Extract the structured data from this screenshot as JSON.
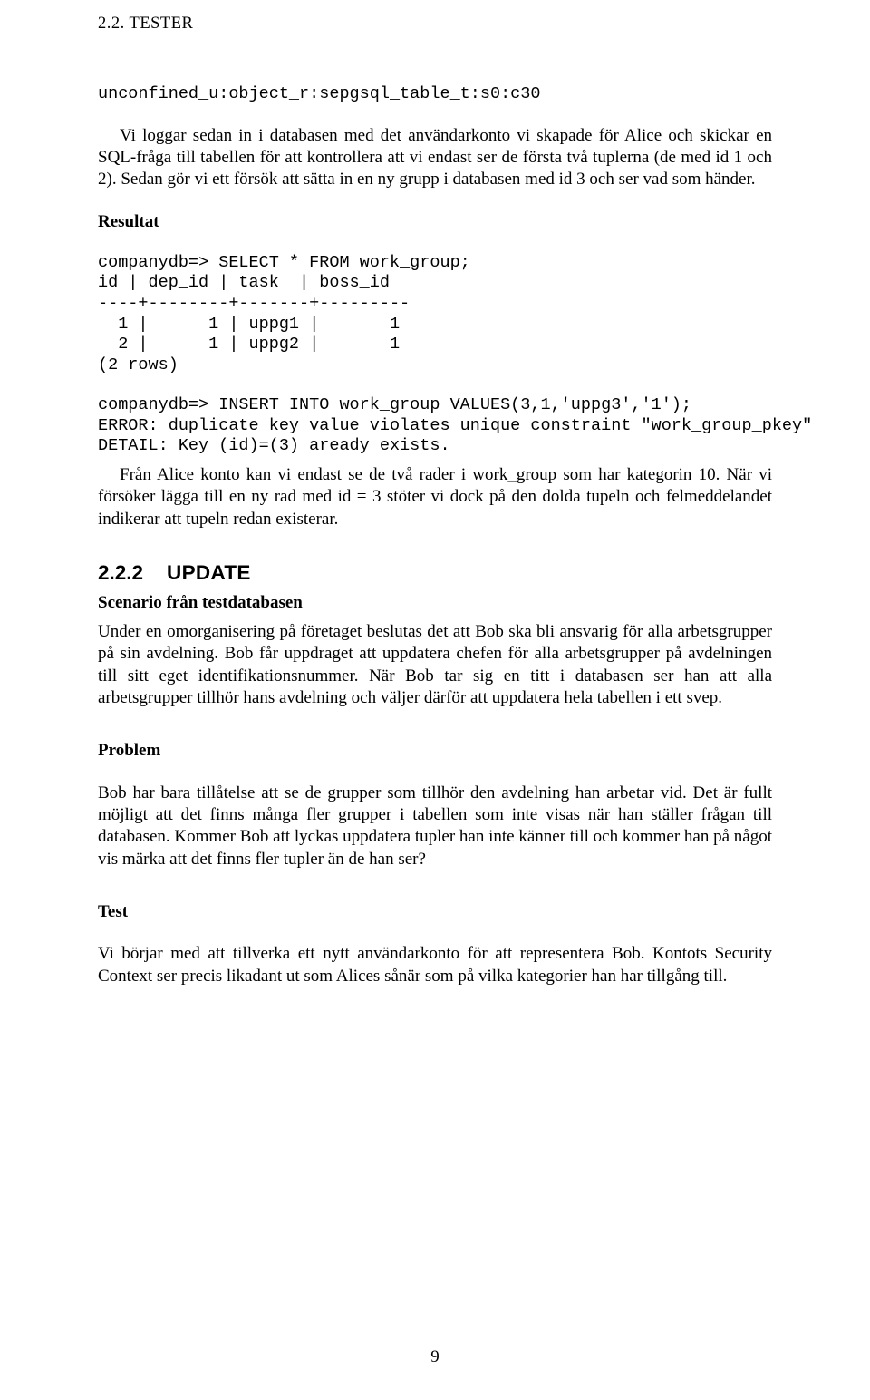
{
  "header": "2.2. TESTER",
  "code0": "unconfined_u:object_r:sepgsql_table_t:s0:c30",
  "p1": "Vi loggar sedan in i databasen med det användarkonto vi skapade för Alice och skickar en SQL-fråga till tabellen för att kontrollera att vi endast ser de första två tuplerna (de med id 1 och 2). Sedan gör vi ett försök att sätta in en ny grupp i databasen med id 3 och ser vad som händer.",
  "h_resultat": "Resultat",
  "code1": "companydb=> SELECT * FROM work_group;\nid | dep_id | task  | boss_id\n----+--------+-------+---------\n  1 |      1 | uppg1 |       1\n  2 |      1 | uppg2 |       1\n(2 rows)",
  "code2": "companydb=> INSERT INTO work_group VALUES(3,1,'uppg3','1');\nERROR: duplicate key value violates unique constraint \"work_group_pkey\"\nDETAIL: Key (id)=(3) aready exists.",
  "p2": "Från Alice konto kan vi endast se de två rader i work_group som har kategorin 10. När vi försöker lägga till en ny rad med id = 3 stöter vi dock på den dolda tupeln och felmeddelandet indikerar att tupeln redan existerar.",
  "secno": "2.2.2",
  "sectitle": "UPDATE",
  "h_scenario": "Scenario från testdatabasen",
  "p3": "Under en omorganisering på företaget beslutas det att Bob ska bli ansvarig för alla arbetsgrupper på sin avdelning. Bob får uppdraget att uppdatera chefen för alla arbetsgrupper på avdelningen till sitt eget identifikationsnummer. När Bob tar sig en titt i databasen ser han att alla arbetsgrupper tillhör hans avdelning och väljer därför att uppdatera hela tabellen i ett svep.",
  "h_problem": "Problem",
  "p4": "Bob har bara tillåtelse att se de grupper som tillhör den avdelning han arbetar vid. Det är fullt möjligt att det finns många fler grupper i tabellen som inte visas när han ställer frågan till databasen. Kommer Bob att lyckas uppdatera tupler han inte känner till och kommer han på något vis märka att det finns fler tupler än de han ser?",
  "h_test": "Test",
  "p5": "Vi börjar med att tillverka ett nytt användarkonto för att representera Bob. Kontots Security Context ser precis likadant ut som Alices sånär som på vilka kategorier han har tillgång till.",
  "pagenum": "9"
}
